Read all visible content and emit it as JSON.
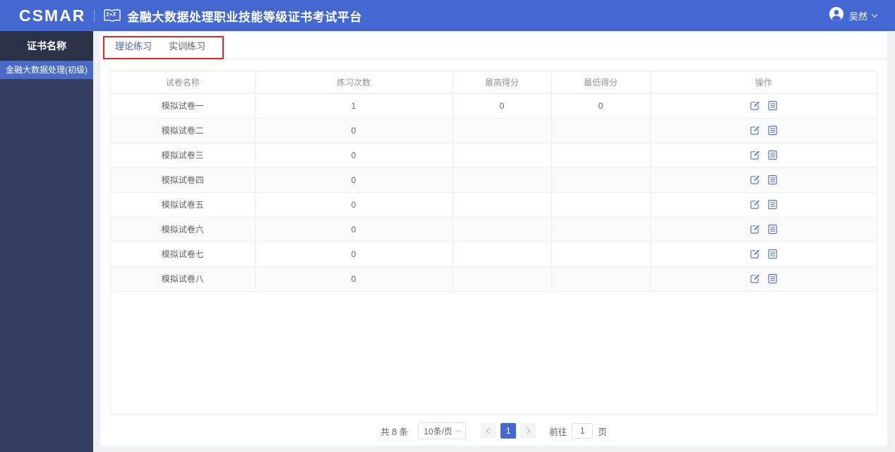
{
  "header": {
    "logo": "CSMAR",
    "badge": "1+X",
    "title": "金融大数据处理职业技能等级证书考试平台",
    "user": {
      "name": "吴然"
    }
  },
  "sidebar": {
    "title": "证书名称",
    "items": [
      {
        "label": "金融大数据处理(初级)",
        "active": true
      }
    ]
  },
  "tabs": [
    {
      "label": "理论练习",
      "active": true
    },
    {
      "label": "实训练习",
      "active": false
    }
  ],
  "table": {
    "columns": [
      "试卷名称",
      "练习次数",
      "最高得分",
      "最低得分",
      "操作"
    ],
    "operation_icons": [
      "edit-icon",
      "report-list-icon"
    ],
    "rows": [
      {
        "name": "模拟试卷一",
        "count": "1",
        "max": "0",
        "min": "0"
      },
      {
        "name": "模拟试卷二",
        "count": "0",
        "max": "",
        "min": ""
      },
      {
        "name": "模拟试卷三",
        "count": "0",
        "max": "",
        "min": ""
      },
      {
        "name": "模拟试卷四",
        "count": "0",
        "max": "",
        "min": ""
      },
      {
        "name": "模拟试卷五",
        "count": "0",
        "max": "",
        "min": ""
      },
      {
        "name": "模拟试卷六",
        "count": "0",
        "max": "",
        "min": ""
      },
      {
        "name": "模拟试卷七",
        "count": "0",
        "max": "",
        "min": ""
      },
      {
        "name": "模拟试卷八",
        "count": "0",
        "max": "",
        "min": ""
      }
    ]
  },
  "pagination": {
    "total_text": "共 8 条",
    "page_size": "10条/页",
    "current_page": "1",
    "goto_label": "前往",
    "goto_value": "1",
    "page_unit": "页"
  },
  "annotation": {
    "type": "red-box",
    "around": "tabs"
  },
  "colors": {
    "header_blue": "#4468d2",
    "sidebar_body": "#353e61",
    "sidebar_header": "#2c3349",
    "sidebar_active_item": "#4a6ac8",
    "tab_active_blue": "#3e62c4",
    "operation_icon_blue": "#5a78cc",
    "annotation_red": "#e32424",
    "stripe_row": "#fafafa"
  }
}
